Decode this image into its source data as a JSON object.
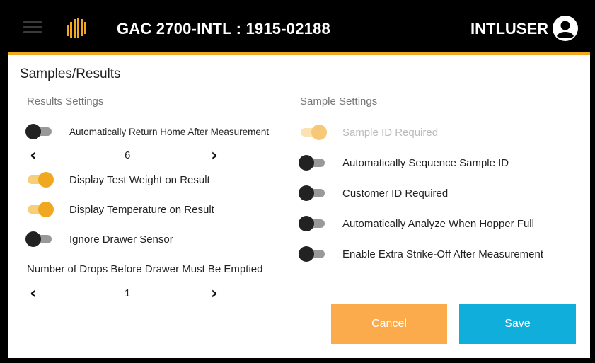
{
  "header": {
    "device_title": "GAC 2700-INTL : 1915-02188",
    "user_name": "INTLUSER",
    "menu_icon": "hamburger-menu-icon",
    "logo_icon": "brand-logo-icon",
    "avatar_icon": "user-account-icon",
    "accent_color": "#f0a820"
  },
  "page": {
    "title": "Samples/Results"
  },
  "results_settings": {
    "title": "Results Settings",
    "auto_return_home": {
      "label": "Automatically Return Home After Measurement",
      "on": false
    },
    "auto_return_stepper": {
      "value": "6",
      "prev_icon": "chevron-left-icon",
      "next_icon": "chevron-right-icon"
    },
    "display_test_weight": {
      "label": "Display Test Weight on Result",
      "on": true
    },
    "display_temperature": {
      "label": "Display Temperature on Result",
      "on": true
    },
    "ignore_drawer_sensor": {
      "label": "Ignore Drawer Sensor",
      "on": false
    },
    "drops_label": "Number of Drops Before Drawer Must Be Emptied",
    "drops_stepper": {
      "value": "1",
      "prev_icon": "chevron-left-icon",
      "next_icon": "chevron-right-icon"
    }
  },
  "sample_settings": {
    "title": "Sample Settings",
    "sample_id_required": {
      "label": "Sample ID Required",
      "on": true,
      "disabled": true
    },
    "auto_sequence_sample_id": {
      "label": "Automatically Sequence Sample ID",
      "on": false
    },
    "customer_id_required": {
      "label": "Customer ID Required",
      "on": false
    },
    "auto_analyze_hopper_full": {
      "label": "Automatically Analyze When Hopper Full",
      "on": false
    },
    "extra_strike_off": {
      "label": "Enable Extra Strike-Off After Measurement",
      "on": false
    }
  },
  "actions": {
    "cancel_label": "Cancel",
    "save_label": "Save",
    "cancel_color": "#fbaa4c",
    "save_color": "#10aedb"
  }
}
